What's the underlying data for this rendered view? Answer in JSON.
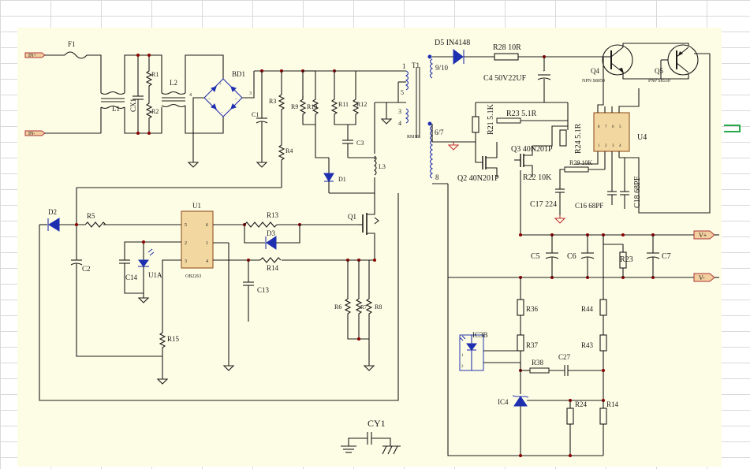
{
  "labels": {
    "f1": "F1",
    "l1": "L1",
    "cx1": "CX1",
    "r1": "R1",
    "r2": "R2",
    "l2": "L2",
    "bd1": "BD1",
    "c1": "C1",
    "r3": "R3",
    "r4": "R4",
    "r9": "R9",
    "r10": "R10",
    "r11": "R11",
    "r12": "R12",
    "c3": "C3",
    "d1": "D1",
    "l3": "L3",
    "q1": "Q1",
    "d2": "D2",
    "r5": "R5",
    "u1": "U1",
    "u1_part": "OB2263",
    "r13": "R13",
    "d3": "D3",
    "r14": "R14",
    "c2": "C2",
    "c14": "C14",
    "u1a": "U1A",
    "c13": "C13",
    "r15": "R15",
    "r6": "R6",
    "r7": "R7",
    "r8": "R8",
    "t1": "T1",
    "transformer_part": "RM10",
    "pin1": "1",
    "pin5": "5",
    "pin3": "3",
    "pin4": "4",
    "pin910": "9/10",
    "pin67": "6/7",
    "pin8": "8",
    "d5": "D5 IN4148",
    "r28": "R28 10R",
    "c4": "C4 50V22UF",
    "r21": "R21 5.1K",
    "r23a": "R23 5.1R",
    "q3": "Q3 40N201P",
    "r24a": "R24 5.1R",
    "q2": "Q2 40N201P",
    "r22": "R22 10K",
    "r29": "R29 10K",
    "c17": "C17 224",
    "c16": "C16 68PF",
    "c18": "C18 68PF",
    "q4": "Q4",
    "q4_part": "NPN S8050",
    "q5": "Q5",
    "q5_part": "PNP S8550",
    "u4": "U4",
    "c5": "C5",
    "c6": "C6",
    "r23": "R23",
    "c7": "C7",
    "vplus": "V+",
    "vminus": "V-",
    "r36": "R36",
    "r37": "R37",
    "r38": "R38",
    "c27": "C27",
    "r44": "R44",
    "r43": "R43",
    "ic3b": "IC3B",
    "ic4": "IC4",
    "r24": "R24",
    "r14b": "R14",
    "cy1": "CY1",
    "u1_pins": [
      "5",
      "6",
      "2",
      "1",
      "3",
      "4"
    ],
    "u4_pins_top": [
      "8",
      "7",
      "6",
      "5"
    ],
    "u4_pins_bot": [
      "1",
      "2",
      "3",
      "4"
    ],
    "ic3b_pins": [
      "1",
      "2"
    ],
    "bd_marks": [
      "+",
      "~",
      "~",
      "-"
    ],
    "l1_pin": "4",
    "l2_pin": "3",
    "ac_in_1": "IN+",
    "ac_in_2": "IN-"
  },
  "colors": {
    "wire": "#1a1a1a",
    "component_blue": "#2432a8",
    "junction": "#8b0000",
    "port_fill": "#f3cfa0",
    "canvas": "#fdfde6",
    "selection_marker": "#2aa84a"
  },
  "icons": [
    "ground-icon",
    "port-arrow-icon",
    "diode-icon",
    "zener-icon",
    "transistor-icon",
    "mosfet-icon",
    "optocoupler-icon",
    "electrolytic-cap-icon"
  ]
}
